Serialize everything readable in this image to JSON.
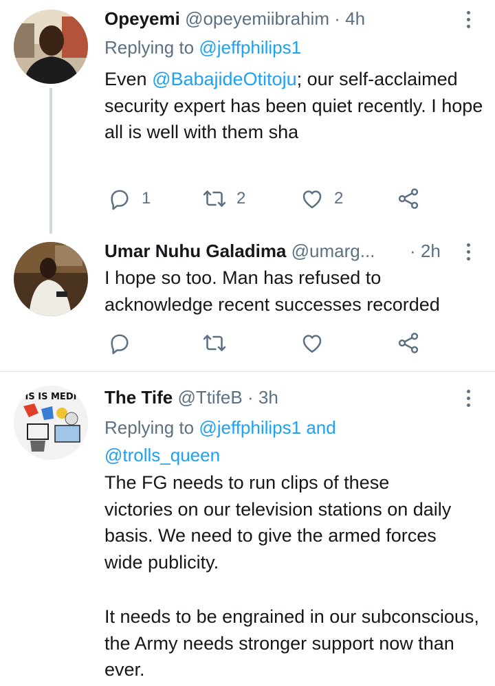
{
  "tweets": [
    {
      "name": "Opeyemi",
      "handle": "@opeyemiibrahim",
      "dot": "·",
      "time": "4h",
      "replying_prefix": "Replying to",
      "replying_to": "@jeffphilips1",
      "text_prefix": "Even",
      "mention": "@BabajideOtitoju",
      "text_rest": "; our self-acclaimed security expert has been quiet recently. I hope all is well with them sha",
      "reply_count": "1",
      "retweet_count": "2",
      "like_count": "2"
    },
    {
      "name": "Umar Nuhu Galadima",
      "handle": "@umarg...",
      "dot": "·",
      "time": "2h",
      "text": "I hope so too. Man has refused to acknowledge recent successes recorded"
    },
    {
      "name": "The Tife",
      "handle": "@TtifeB",
      "dot": "·",
      "time": "3h",
      "replying_prefix": "Replying to",
      "replying_to_1": "@jeffphilips1",
      "replying_and": "and",
      "replying_to_2": "@trolls_queen",
      "avatar_caption": "IS IS MEDI",
      "para1": "The FG needs to run clips of these victories on our television stations on daily basis. We need to give the armed forces wide publicity.",
      "para2": "It needs to be engrained in our subconscious, the Army needs stronger support now than ever."
    }
  ],
  "icons": {
    "reply": "reply-icon",
    "retweet": "retweet-icon",
    "like": "heart-icon",
    "share": "share-icon",
    "more": "more-vertical-icon"
  },
  "colors": {
    "text": "#14171a",
    "secondary": "#5b7083",
    "link": "#1da1f2",
    "divider": "#e1e8ed"
  }
}
